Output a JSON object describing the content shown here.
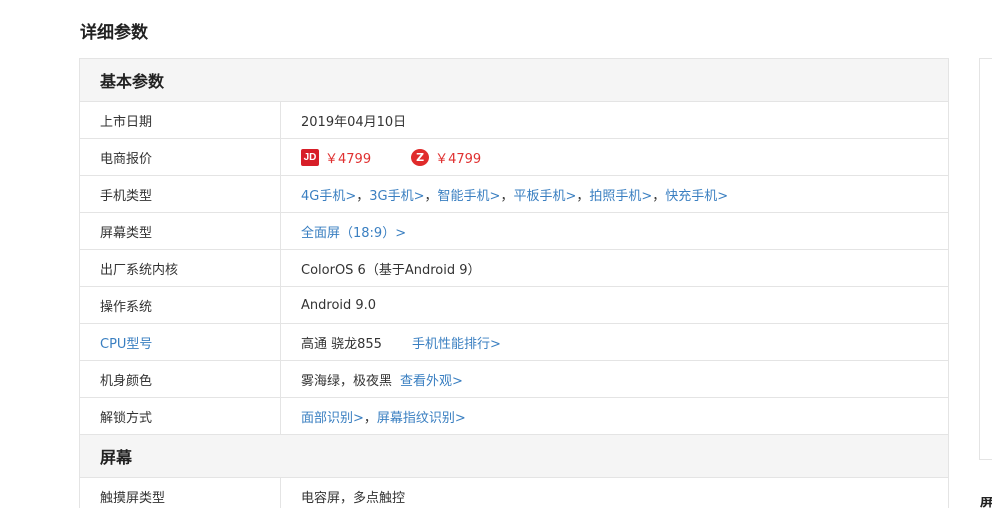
{
  "page": {
    "title": "详细参数"
  },
  "basic": {
    "heading": "基本参数",
    "release": {
      "label": "上市日期",
      "value": "2019年04月10日"
    },
    "price": {
      "label": "电商报价",
      "shops": [
        {
          "icon": "jd-logo-icon",
          "glyph": "JD",
          "price": "￥4799"
        },
        {
          "icon": "zol-logo-icon",
          "glyph": "Z",
          "price": "￥4799"
        }
      ]
    },
    "phone_type": {
      "label": "手机类型",
      "links": [
        "4G手机>",
        "3G手机>",
        "智能手机>",
        "平板手机>",
        "拍照手机>",
        "快充手机>"
      ],
      "separator": "，"
    },
    "screen_type": {
      "label": "屏幕类型",
      "link": "全面屏（18:9）>"
    },
    "factory_os": {
      "label": "出厂系统内核",
      "value": "ColorOS 6（基于Android 9）"
    },
    "os": {
      "label": "操作系统",
      "value": "Android 9.0"
    },
    "cpu": {
      "label": "CPU型号",
      "value": "高通 骁龙855",
      "link": "手机性能排行>"
    },
    "color": {
      "label": "机身颜色",
      "value": "雾海绿，极夜黑",
      "link": "查看外观>"
    },
    "unlock": {
      "label": "解锁方式",
      "links": [
        "面部识别>",
        "屏幕指纹识别>"
      ],
      "separator": "，"
    }
  },
  "screen": {
    "heading": "屏幕",
    "touch_type": {
      "label": "触摸屏类型",
      "value": "电容屏，多点触控"
    }
  },
  "side": {
    "partial_text": "屏"
  },
  "colors": {
    "link": "#3a7fc1",
    "price": "#e03131",
    "border": "#e4e4e4",
    "header_bg": "#f5f5f5"
  }
}
